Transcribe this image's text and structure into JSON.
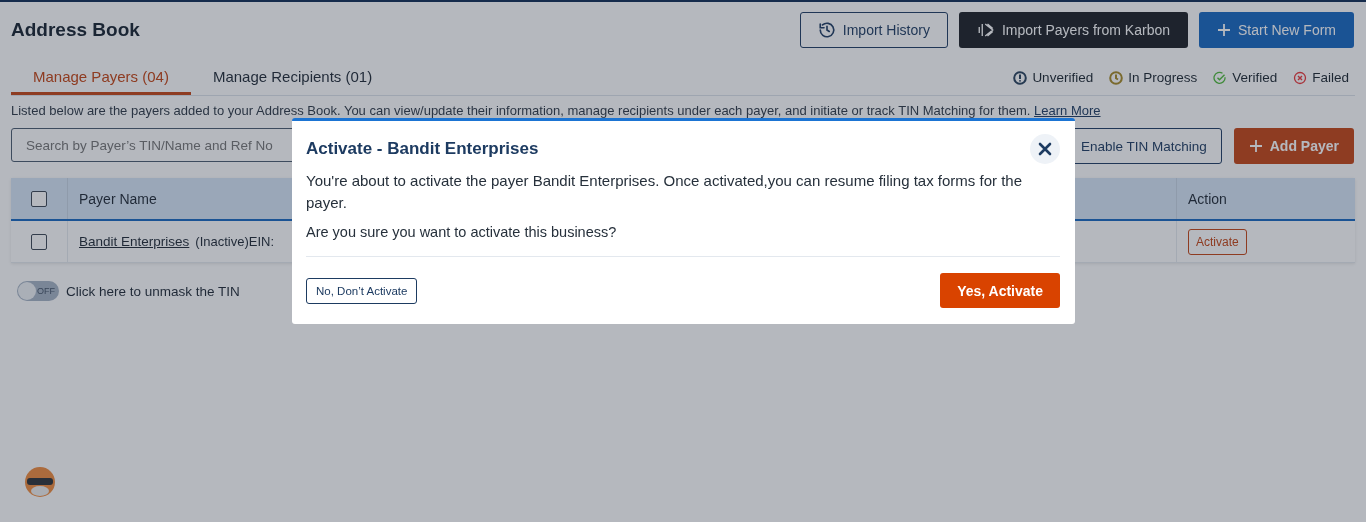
{
  "page_title": "Address Book",
  "header_buttons": [
    {
      "kind": "outline",
      "label": "Import History"
    },
    {
      "kind": "dark",
      "label": "Import Payers from Karbon"
    },
    {
      "kind": "primary",
      "label": "Start New Form"
    }
  ],
  "tabs": [
    {
      "label": "Manage Payers (04)",
      "selected": true
    },
    {
      "label": "Manage Recipients (01)",
      "selected": false
    }
  ],
  "legend": [
    {
      "kind": "unverified",
      "label": "Unverified",
      "color": "#263a52"
    },
    {
      "kind": "in_progress",
      "label": "In Progress",
      "color": "#7a6a2e"
    },
    {
      "kind": "verified",
      "label": "Verified",
      "color": "#3f8a3a"
    },
    {
      "kind": "failed",
      "label": "Failed",
      "color": "#a8323a"
    }
  ],
  "description": {
    "text": "Listed below are the payers added to your Address Book. You can view/update their information, manage recipients under each payer, and initiate or track TIN Matching for them.",
    "link": "Learn More"
  },
  "search": {
    "placeholder": "Search by Payer’s TIN/Name and Ref No"
  },
  "toolbar_buttons": [
    {
      "kind": "outline",
      "label": "Enable TIN Matching"
    },
    {
      "kind": "accent",
      "label": "Add Payer"
    }
  ],
  "table": {
    "columns": [
      "Payer Name",
      "Action"
    ],
    "rows": [
      {
        "checked": false,
        "payer_name": "Bandit Enterprises",
        "details": "(Inactive)EIN:",
        "action": "Activate"
      }
    ],
    "header_checked": false
  },
  "unmask_toggle": {
    "on": false,
    "state_label": "OFF",
    "label": "Click here to unmask the TIN"
  },
  "modal": {
    "title": "Activate - Bandit Enterprises",
    "message": "You're about to activate the payer Bandit Enterprises. Once activated,you can resume filing tax forms for the payer.",
    "question": "Are you sure you want to activate this business?",
    "cancel": "No, Don’t Activate",
    "confirm": "Yes, Activate"
  }
}
